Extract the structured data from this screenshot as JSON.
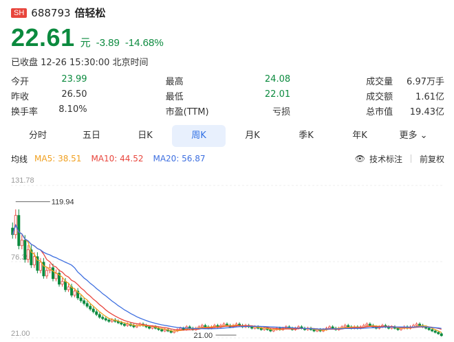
{
  "header": {
    "exchange": "SH",
    "code": "688793",
    "name": "倍轻松"
  },
  "quote": {
    "price": "22.61",
    "unit": "元",
    "change": "-3.89",
    "change_pct": "-14.68%",
    "time": "已收盘 12-26 15:30:00 北京时间"
  },
  "stats": [
    [
      {
        "label": "今开",
        "value": "23.99",
        "color": "g"
      },
      {
        "label": "最高",
        "value": "24.08",
        "color": "g"
      },
      {
        "label": "成交量",
        "value": "6.97万手",
        "color": ""
      }
    ],
    [
      {
        "label": "昨收",
        "value": "26.50",
        "color": ""
      },
      {
        "label": "最低",
        "value": "22.01",
        "color": "g"
      },
      {
        "label": "成交额",
        "value": "1.61亿",
        "color": ""
      }
    ],
    [
      {
        "label": "换手率",
        "value": "8.10%",
        "color": ""
      },
      {
        "label": "市盈(TTM)",
        "value": "亏损",
        "color": ""
      },
      {
        "label": "总市值",
        "value": "19.43亿",
        "color": ""
      }
    ]
  ],
  "tabs": [
    "分时",
    "五日",
    "日K",
    "周K",
    "月K",
    "季K",
    "年K",
    "更多"
  ],
  "active_tab": 3,
  "ma": {
    "label": "均线",
    "ma5": "MA5: 38.51",
    "ma10": "MA10: 44.52",
    "ma20": "MA20: 56.87"
  },
  "tools": {
    "annotation": "技术标注",
    "adjust": "前复权"
  },
  "colors": {
    "up": "#e8453c",
    "down": "#0b8a3e",
    "ma5": "#f0a020",
    "ma10": "#e8453c",
    "ma20": "#3d6fe0",
    "accent": "#2f6fe4"
  },
  "chart_data": {
    "type": "candlestick",
    "y_ticks": [
      "131.78",
      "76.39",
      "21.00"
    ],
    "ylim": [
      21.0,
      131.78
    ],
    "max_label": "119.94",
    "min_label": "21.00",
    "closes": [
      96,
      110,
      88,
      92,
      78,
      85,
      74,
      80,
      70,
      76,
      66,
      70,
      72,
      64,
      68,
      60,
      62,
      56,
      58,
      52,
      55,
      50,
      48,
      46,
      44,
      42,
      40,
      38,
      36,
      35,
      34,
      33,
      34,
      33,
      32,
      31,
      30,
      31,
      30,
      29,
      30,
      31,
      30,
      29,
      28,
      29,
      28,
      27,
      26,
      27,
      26,
      25,
      26,
      27,
      28,
      27,
      29,
      28,
      27,
      28,
      29,
      30,
      29,
      28,
      29,
      30,
      29,
      30,
      31,
      30,
      29,
      30,
      31,
      30,
      29,
      30,
      29,
      28,
      29,
      28,
      27,
      28,
      27,
      26,
      27,
      28,
      27,
      28,
      29,
      28,
      27,
      28,
      29,
      28,
      27,
      28,
      27,
      26,
      27,
      26,
      27,
      28,
      29,
      28,
      27,
      28,
      29,
      30,
      29,
      28,
      29,
      28,
      29,
      30,
      31,
      30,
      29,
      28,
      29,
      30,
      29,
      28,
      29,
      28,
      27,
      28,
      29,
      28,
      29,
      30,
      31,
      30,
      29,
      28,
      27,
      26,
      25,
      24,
      22.6
    ]
  }
}
